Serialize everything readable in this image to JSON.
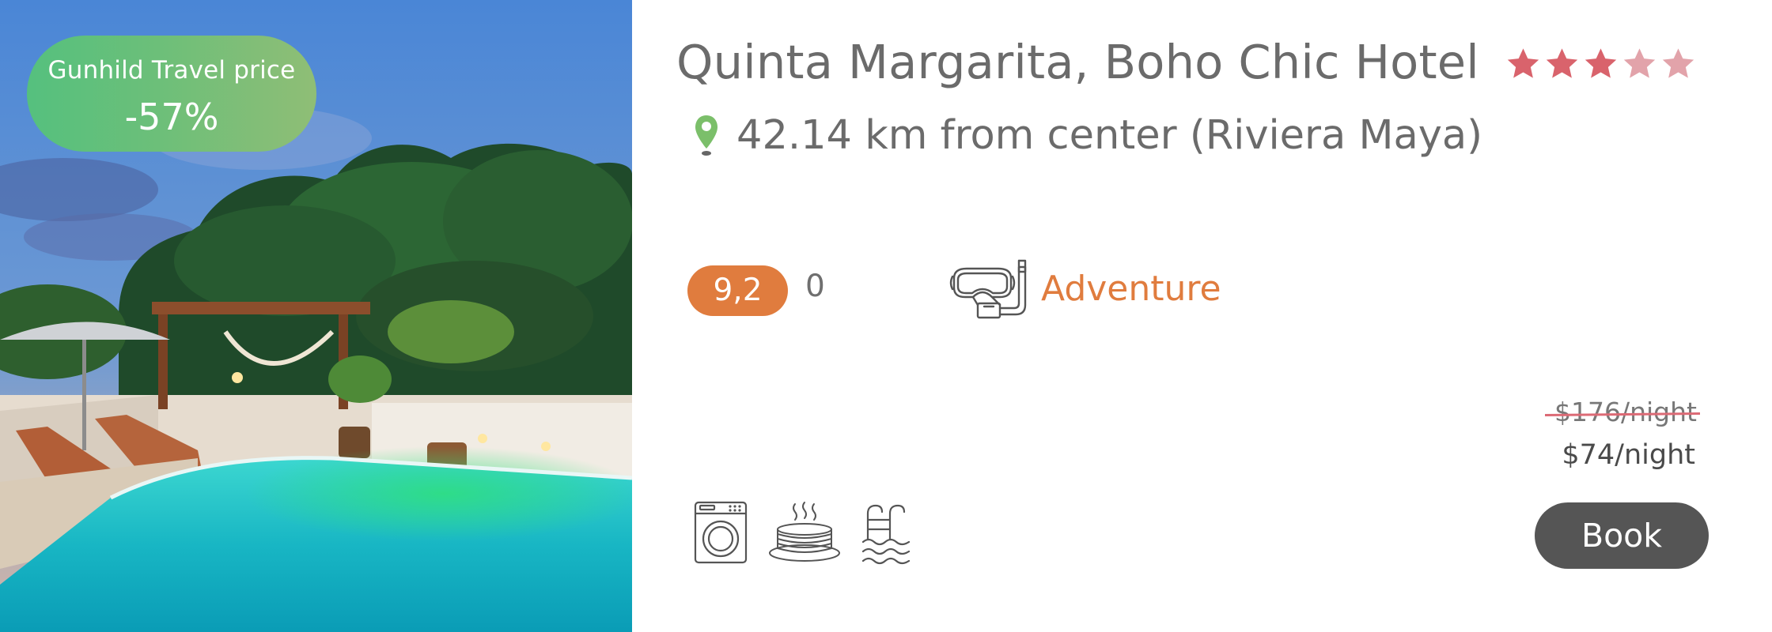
{
  "hotel": {
    "name": "Quinta Margarita, Boho Chic Hotel",
    "stars_filled": 3,
    "stars_total": 5,
    "distance": "42.14 km from center (Riviera Maya)"
  },
  "promo": {
    "label": "Gunhild Travel price",
    "discount": "-57%"
  },
  "rating": {
    "score": "9,2",
    "reviews": "0"
  },
  "theme": {
    "icon": "snorkel-mask-icon",
    "label": "Adventure"
  },
  "pricing": {
    "old_price": "$176/night",
    "new_price": "$74/night"
  },
  "actions": {
    "book_label": "Book"
  },
  "amenities": [
    "washing-machine-icon",
    "breakfast-pancakes-icon",
    "pool-icon"
  ],
  "colors": {
    "accent_orange": "#e07c3e",
    "star_filled": "#d9636c",
    "star_faded": "#e2a3aa",
    "badge_green": "#55c07e",
    "text_grey": "#6b6b6b",
    "button_dark": "#555555",
    "pin_green": "#7bbf6a"
  }
}
